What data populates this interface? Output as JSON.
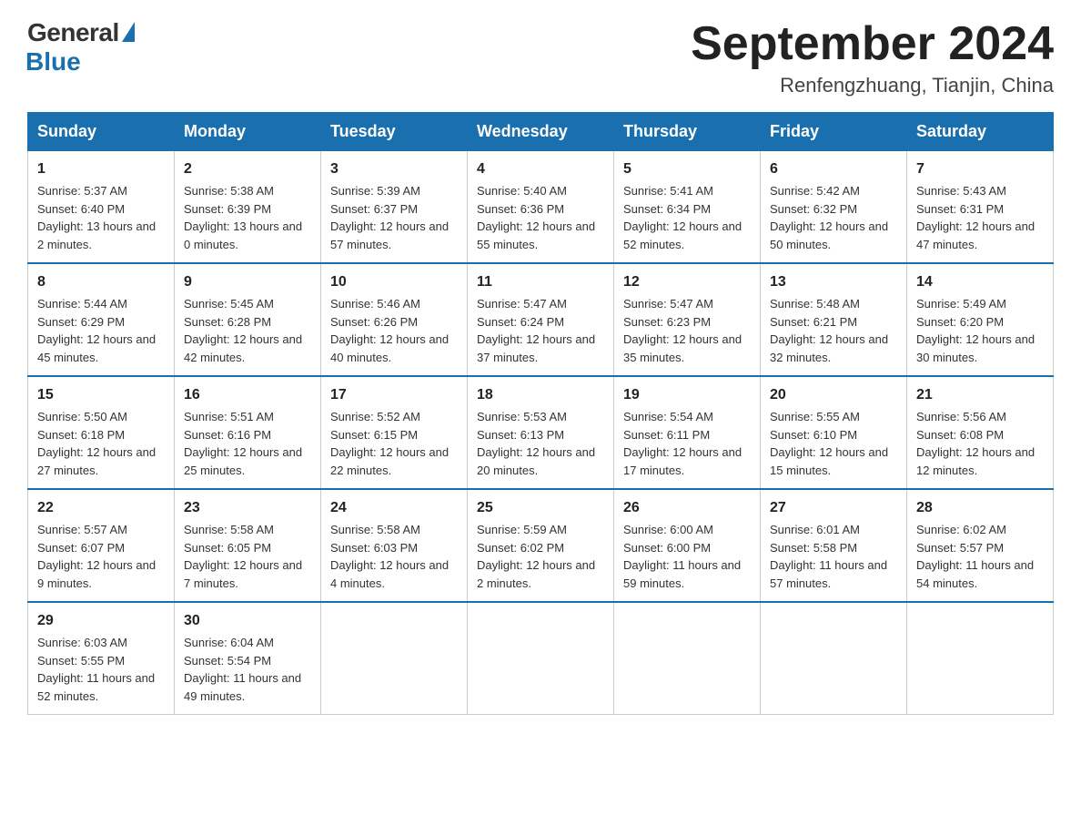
{
  "logo": {
    "general": "General",
    "blue": "Blue"
  },
  "title": "September 2024",
  "subtitle": "Renfengzhuang, Tianjin, China",
  "days_of_week": [
    "Sunday",
    "Monday",
    "Tuesday",
    "Wednesday",
    "Thursday",
    "Friday",
    "Saturday"
  ],
  "weeks": [
    [
      {
        "day": "1",
        "sunrise": "5:37 AM",
        "sunset": "6:40 PM",
        "daylight": "13 hours and 2 minutes."
      },
      {
        "day": "2",
        "sunrise": "5:38 AM",
        "sunset": "6:39 PM",
        "daylight": "13 hours and 0 minutes."
      },
      {
        "day": "3",
        "sunrise": "5:39 AM",
        "sunset": "6:37 PM",
        "daylight": "12 hours and 57 minutes."
      },
      {
        "day": "4",
        "sunrise": "5:40 AM",
        "sunset": "6:36 PM",
        "daylight": "12 hours and 55 minutes."
      },
      {
        "day": "5",
        "sunrise": "5:41 AM",
        "sunset": "6:34 PM",
        "daylight": "12 hours and 52 minutes."
      },
      {
        "day": "6",
        "sunrise": "5:42 AM",
        "sunset": "6:32 PM",
        "daylight": "12 hours and 50 minutes."
      },
      {
        "day": "7",
        "sunrise": "5:43 AM",
        "sunset": "6:31 PM",
        "daylight": "12 hours and 47 minutes."
      }
    ],
    [
      {
        "day": "8",
        "sunrise": "5:44 AM",
        "sunset": "6:29 PM",
        "daylight": "12 hours and 45 minutes."
      },
      {
        "day": "9",
        "sunrise": "5:45 AM",
        "sunset": "6:28 PM",
        "daylight": "12 hours and 42 minutes."
      },
      {
        "day": "10",
        "sunrise": "5:46 AM",
        "sunset": "6:26 PM",
        "daylight": "12 hours and 40 minutes."
      },
      {
        "day": "11",
        "sunrise": "5:47 AM",
        "sunset": "6:24 PM",
        "daylight": "12 hours and 37 minutes."
      },
      {
        "day": "12",
        "sunrise": "5:47 AM",
        "sunset": "6:23 PM",
        "daylight": "12 hours and 35 minutes."
      },
      {
        "day": "13",
        "sunrise": "5:48 AM",
        "sunset": "6:21 PM",
        "daylight": "12 hours and 32 minutes."
      },
      {
        "day": "14",
        "sunrise": "5:49 AM",
        "sunset": "6:20 PM",
        "daylight": "12 hours and 30 minutes."
      }
    ],
    [
      {
        "day": "15",
        "sunrise": "5:50 AM",
        "sunset": "6:18 PM",
        "daylight": "12 hours and 27 minutes."
      },
      {
        "day": "16",
        "sunrise": "5:51 AM",
        "sunset": "6:16 PM",
        "daylight": "12 hours and 25 minutes."
      },
      {
        "day": "17",
        "sunrise": "5:52 AM",
        "sunset": "6:15 PM",
        "daylight": "12 hours and 22 minutes."
      },
      {
        "day": "18",
        "sunrise": "5:53 AM",
        "sunset": "6:13 PM",
        "daylight": "12 hours and 20 minutes."
      },
      {
        "day": "19",
        "sunrise": "5:54 AM",
        "sunset": "6:11 PM",
        "daylight": "12 hours and 17 minutes."
      },
      {
        "day": "20",
        "sunrise": "5:55 AM",
        "sunset": "6:10 PM",
        "daylight": "12 hours and 15 minutes."
      },
      {
        "day": "21",
        "sunrise": "5:56 AM",
        "sunset": "6:08 PM",
        "daylight": "12 hours and 12 minutes."
      }
    ],
    [
      {
        "day": "22",
        "sunrise": "5:57 AM",
        "sunset": "6:07 PM",
        "daylight": "12 hours and 9 minutes."
      },
      {
        "day": "23",
        "sunrise": "5:58 AM",
        "sunset": "6:05 PM",
        "daylight": "12 hours and 7 minutes."
      },
      {
        "day": "24",
        "sunrise": "5:58 AM",
        "sunset": "6:03 PM",
        "daylight": "12 hours and 4 minutes."
      },
      {
        "day": "25",
        "sunrise": "5:59 AM",
        "sunset": "6:02 PM",
        "daylight": "12 hours and 2 minutes."
      },
      {
        "day": "26",
        "sunrise": "6:00 AM",
        "sunset": "6:00 PM",
        "daylight": "11 hours and 59 minutes."
      },
      {
        "day": "27",
        "sunrise": "6:01 AM",
        "sunset": "5:58 PM",
        "daylight": "11 hours and 57 minutes."
      },
      {
        "day": "28",
        "sunrise": "6:02 AM",
        "sunset": "5:57 PM",
        "daylight": "11 hours and 54 minutes."
      }
    ],
    [
      {
        "day": "29",
        "sunrise": "6:03 AM",
        "sunset": "5:55 PM",
        "daylight": "11 hours and 52 minutes."
      },
      {
        "day": "30",
        "sunrise": "6:04 AM",
        "sunset": "5:54 PM",
        "daylight": "11 hours and 49 minutes."
      },
      null,
      null,
      null,
      null,
      null
    ]
  ]
}
